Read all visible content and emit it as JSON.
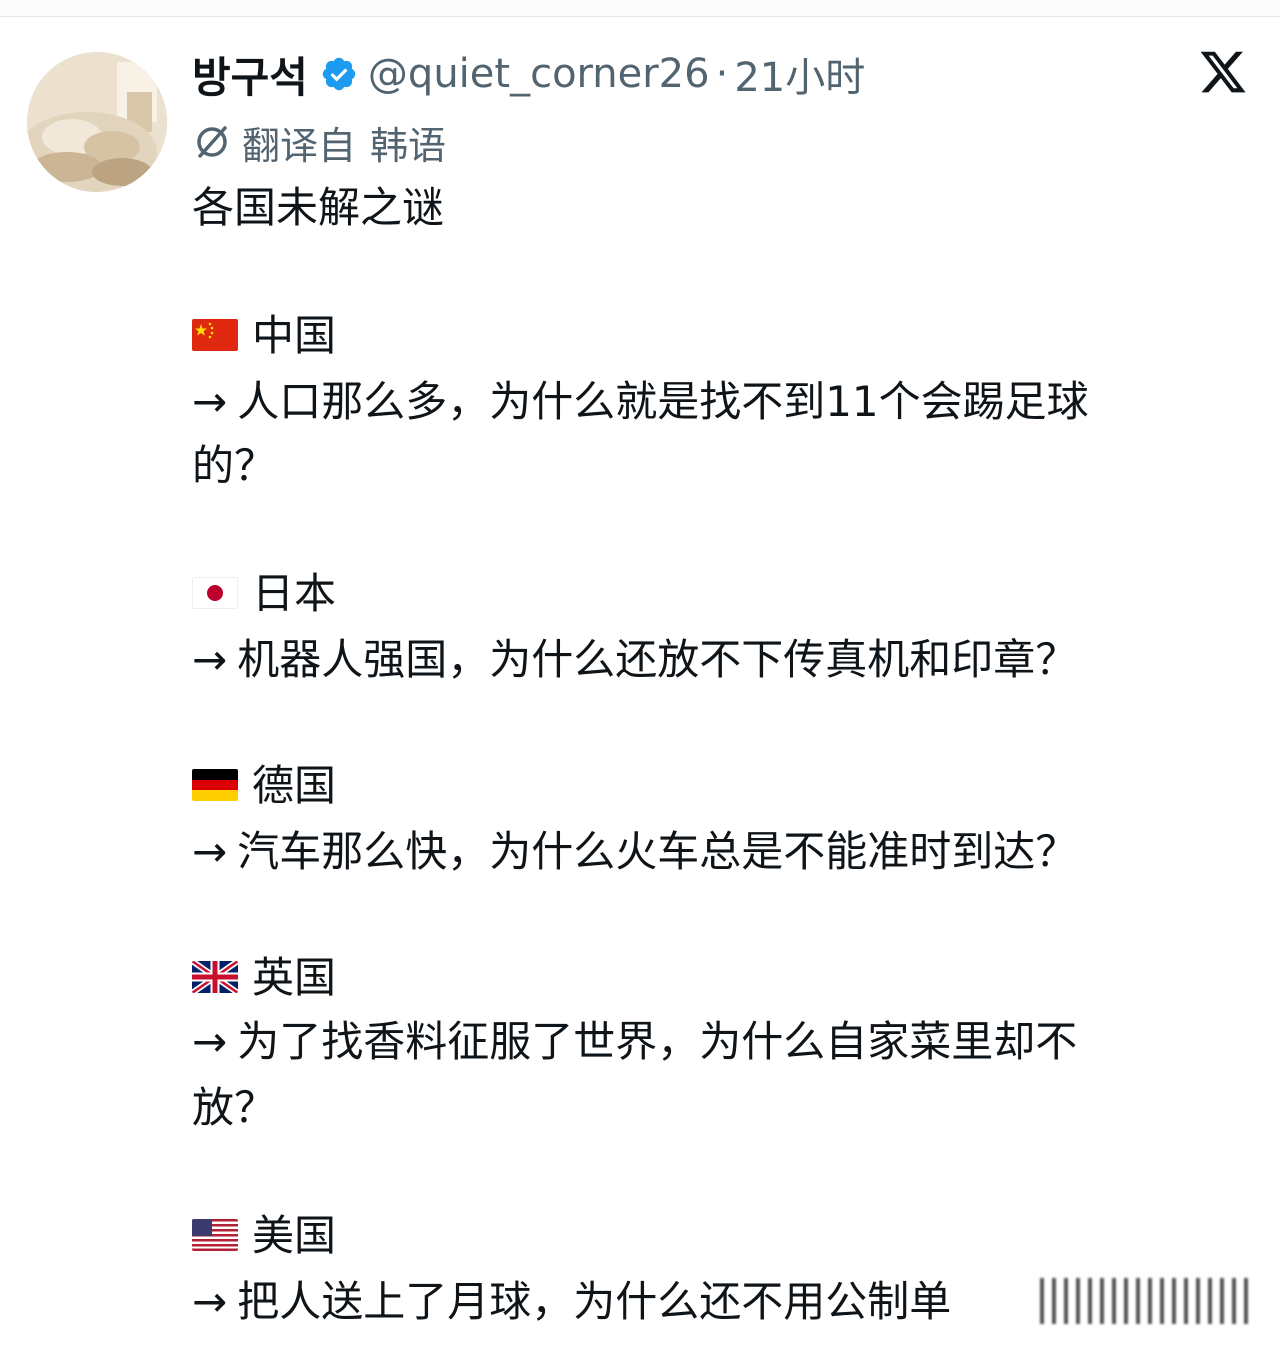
{
  "author": {
    "display_name": "방구석",
    "handle": "@quiet_corner26",
    "separator": "·",
    "time": "21小时",
    "verified": true
  },
  "translation": {
    "label": "翻译自",
    "language": "韩语"
  },
  "post": {
    "title": "各国未解之谜",
    "arrow": "→",
    "entries": [
      {
        "flag": "china-flag",
        "country": "中国",
        "lines": [
          "人口那么多，为什么就是找不到11个会踢足球",
          "的？"
        ]
      },
      {
        "flag": "japan-flag",
        "country": "日本",
        "lines": [
          "机器人强国，为什么还放不下传真机和印章？"
        ]
      },
      {
        "flag": "germany-flag",
        "country": "德国",
        "lines": [
          "汽车那么快，为什么火车总是不能准时到达？"
        ]
      },
      {
        "flag": "uk-flag",
        "country": "英国",
        "lines": [
          "为了找香料征服了世界，为什么自家菜里却不",
          "放？"
        ]
      },
      {
        "flag": "usa-flag",
        "country": "美国",
        "lines": [
          "把人送上了月球，为什么还不用公制单"
        ]
      }
    ]
  },
  "colors": {
    "text": "#0f1419",
    "secondary": "#536471",
    "verified_blue": "#1d9bf0"
  },
  "icons": [
    "verified-badge-icon",
    "x-logo-icon",
    "translate-icon"
  ]
}
